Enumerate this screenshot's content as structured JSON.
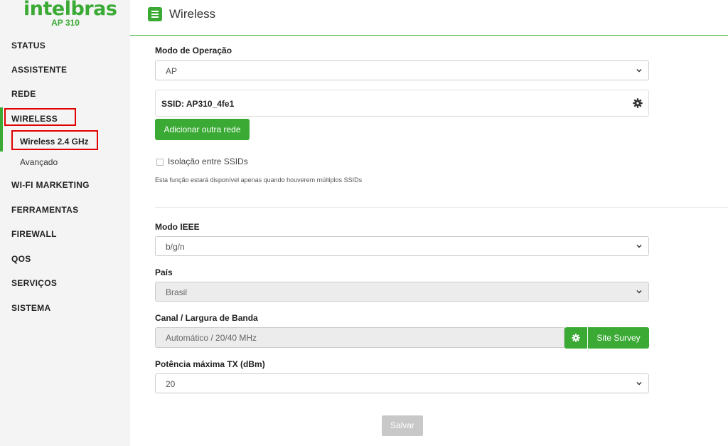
{
  "brand": {
    "name": "intelbras",
    "model": "AP 310"
  },
  "colors": {
    "accent": "#3aaa35",
    "highlight": "#e00000"
  },
  "header": {
    "title": "Wireless",
    "menu_icon": "hamburger-icon"
  },
  "sidebar": {
    "items": [
      {
        "label": "STATUS"
      },
      {
        "label": "ASSISTENTE"
      },
      {
        "label": "REDE"
      },
      {
        "label": "WIRELESS",
        "active": true
      },
      {
        "label": "WI-FI MARKETING"
      },
      {
        "label": "FERRAMENTAS"
      },
      {
        "label": "FIREWALL"
      },
      {
        "label": "QOS"
      },
      {
        "label": "SERVIÇOS"
      },
      {
        "label": "SISTEMA"
      }
    ],
    "subitems": [
      {
        "label": "Wireless 2.4 GHz",
        "active": true
      },
      {
        "label": "Avançado"
      }
    ]
  },
  "form": {
    "mode_label": "Modo de Operação",
    "mode_value": "AP",
    "ssid_text": "SSID: AP310_4fe1",
    "add_network_label": "Adicionar outra rede",
    "isolation_label": "Isolação entre SSIDs",
    "isolation_checked": false,
    "isolation_help": "Esta função estará disponível apenas quando houverem múltiplos SSIDs",
    "ieee_label": "Modo IEEE",
    "ieee_value": "b/g/n",
    "country_label": "País",
    "country_value": "Brasil",
    "channel_label": "Canal / Largura de Banda",
    "channel_value": "Automático / 20/40 MHz",
    "site_survey_label": "Site Survey",
    "tx_label": "Potência máxima TX (dBm)",
    "tx_value": "20",
    "save_label": "Salvar"
  }
}
